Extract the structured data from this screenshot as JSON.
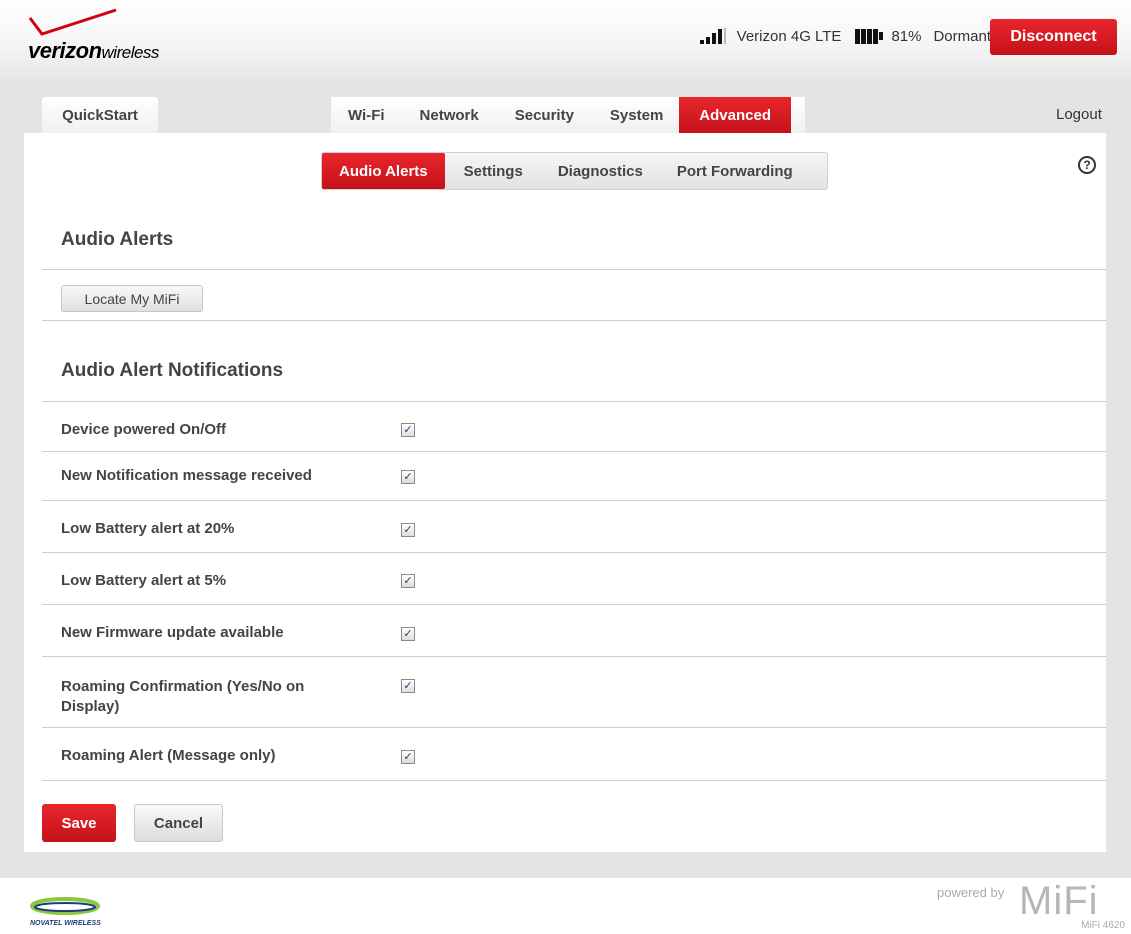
{
  "header": {
    "logo_brand": "verizon",
    "logo_suffix": "wireless",
    "network_name": "Verizon 4G LTE",
    "battery_percent": "81%",
    "connection_state": "Dormant",
    "signal_bars": 4,
    "disconnect_label": "Disconnect",
    "accent_color": "#cd040b"
  },
  "nav": {
    "quickstart_label": "QuickStart",
    "tabs": [
      {
        "label": "Wi-Fi",
        "active": false
      },
      {
        "label": "Network",
        "active": false
      },
      {
        "label": "Security",
        "active": false
      },
      {
        "label": "System",
        "active": false
      },
      {
        "label": "Advanced",
        "active": true
      }
    ],
    "logout_label": "Logout"
  },
  "subtabs": [
    {
      "label": "Audio Alerts",
      "active": true
    },
    {
      "label": "Settings",
      "active": false
    },
    {
      "label": "Diagnostics",
      "active": false
    },
    {
      "label": "Port Forwarding",
      "active": false
    }
  ],
  "help_icon": "?",
  "audio_alerts": {
    "title": "Audio Alerts",
    "locate_button": "Locate My MiFi"
  },
  "notifications": {
    "title": "Audio Alert Notifications",
    "rows": [
      {
        "label": "Device powered On/Off",
        "checked": true
      },
      {
        "label": "New Notification message received",
        "checked": true
      },
      {
        "label": "Low Battery alert at 20%",
        "checked": true
      },
      {
        "label": "Low Battery alert at 5%",
        "checked": true
      },
      {
        "label": "New Firmware update available",
        "checked": true
      },
      {
        "label": "Roaming Confirmation (Yes/No on Display)",
        "checked": true
      },
      {
        "label": "Roaming Alert (Message only)",
        "checked": true
      }
    ]
  },
  "actions": {
    "save_label": "Save",
    "cancel_label": "Cancel"
  },
  "footer": {
    "vendor": "NOVATEL WIRELESS",
    "powered_by": "powered by",
    "product": "MiFi",
    "model": "MiFi 4620"
  }
}
